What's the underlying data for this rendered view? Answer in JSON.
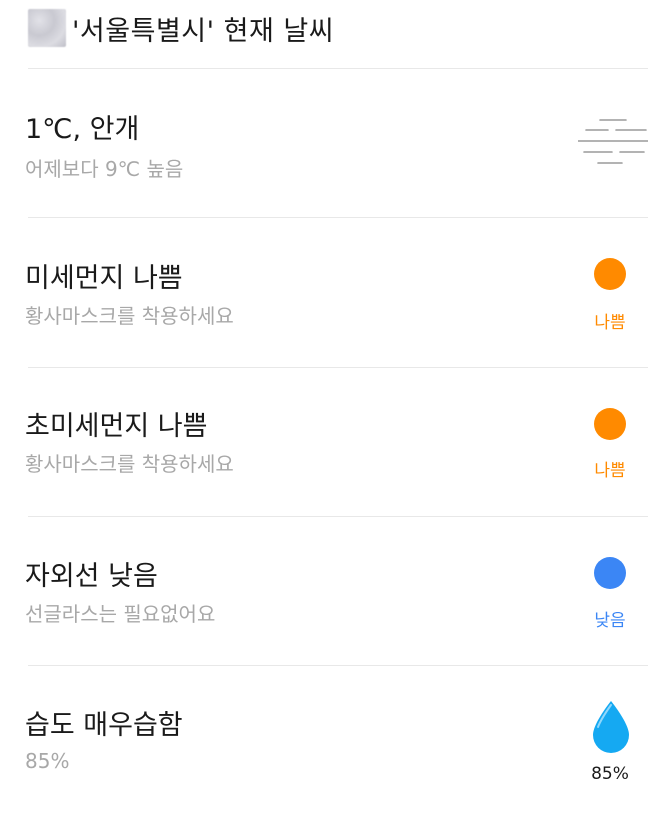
{
  "header": {
    "title": "'서울특별시' 현재 날씨"
  },
  "rows": [
    {
      "title": "1℃, 안개",
      "subtitle": "어제보다 9℃ 높음",
      "icon": "fog-icon"
    },
    {
      "title": "미세먼지 나쁨",
      "subtitle": "황사마스크를 착용하세요",
      "status": "나쁨",
      "status_color": "#ff8a00"
    },
    {
      "title": "초미세먼지 나쁨",
      "subtitle": "황사마스크를 착용하세요",
      "status": "나쁨",
      "status_color": "#ff8a00"
    },
    {
      "title": "자외선 낮음",
      "subtitle": "선글라스는 필요없어요",
      "status": "낮음",
      "status_color": "#3b86f5"
    },
    {
      "title": "습도 매우습함",
      "subtitle": "85%",
      "status": "85%",
      "status_color": "#15a9f2",
      "icon": "water-drop-icon"
    }
  ],
  "colors": {
    "divider": "#e8e8e8",
    "subtitle": "#a8a8a8",
    "text": "#1a1a1a"
  }
}
